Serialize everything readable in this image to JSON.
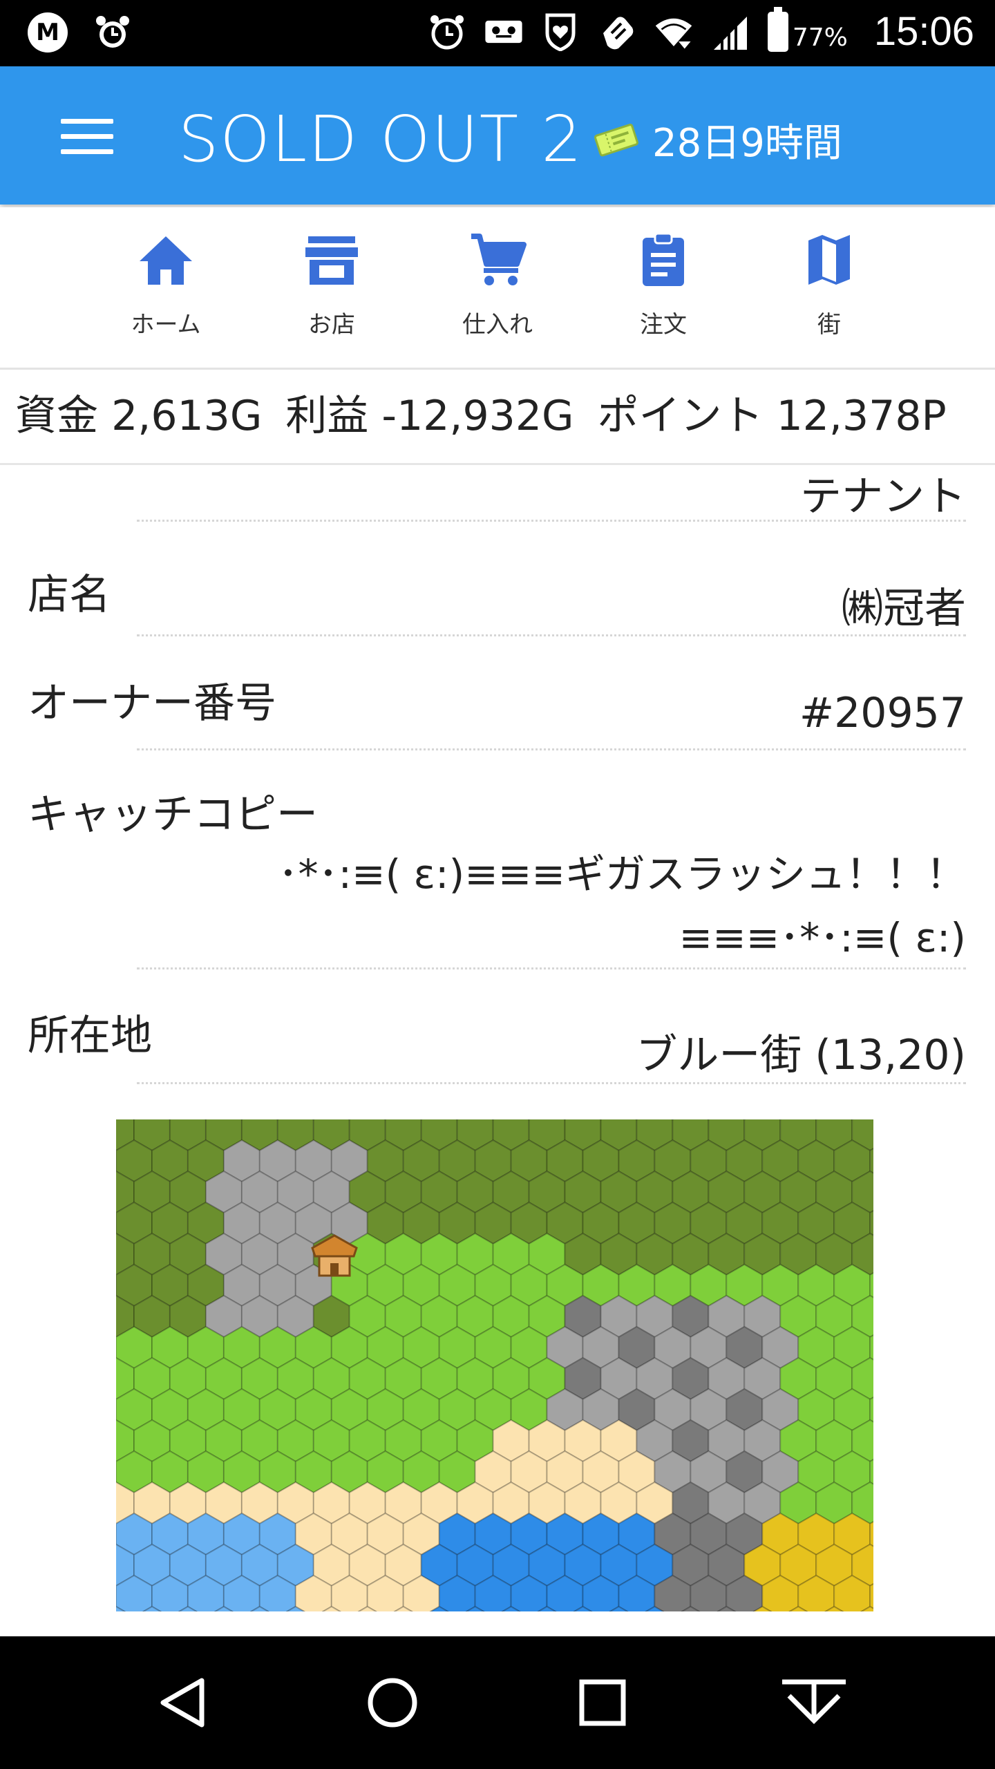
{
  "status_bar": {
    "left_icons": [
      "m-logo-icon",
      "alarm-icon"
    ],
    "right_icons": [
      "alarm-icon",
      "voicemail-icon",
      "heart-shield-icon",
      "hand-icon",
      "wifi-icon",
      "signal-icon",
      "battery-icon"
    ],
    "battery_percent": "77%",
    "time": "15:06",
    "m_logo_text": "M"
  },
  "app_bar": {
    "title": "SOLD OUT 2",
    "time_remaining": "28日9時間",
    "menu_icon": "hamburger-icon",
    "ticket_icon": "ticket-icon"
  },
  "nav": {
    "items": [
      {
        "label": "ホーム",
        "icon": "home-icon"
      },
      {
        "label": "お店",
        "icon": "store-icon"
      },
      {
        "label": "仕入れ",
        "icon": "cart-icon"
      },
      {
        "label": "注文",
        "icon": "clipboard-icon"
      },
      {
        "label": "街",
        "icon": "map-icon"
      }
    ],
    "accent": "#3a6fd8"
  },
  "stats": {
    "funds": "資金 2,613G",
    "profit": "利益 -12,932G",
    "points": "ポイント 12,378P"
  },
  "details": {
    "tenant_value": "テナント",
    "shop_name_label": "店名",
    "shop_name_value": "㈱冠者",
    "owner_label": "オーナー番号",
    "owner_value": "#20957",
    "catchcopy_label": "キャッチコピー",
    "catchcopy_line1": "･*･:≡( ε:)≡≡≡ギガスラッシュ！！！",
    "catchcopy_line2": "≡≡≡･*･:≡( ε:)",
    "location_label": "所在地",
    "location_value": "ブルー街 (13,20)"
  },
  "colors": {
    "app_bar": "#2f96ec",
    "forest": "#6b8f2e",
    "grass": "#7fcf3a",
    "rock": "#a3a3a3",
    "dark_rock": "#7a7a7a",
    "sand": "#fce3b0",
    "water": "#2e8ce8",
    "light_water": "#6ab2f2",
    "gold": "#e6c21e",
    "shop": "#d2852e"
  },
  "system_nav": [
    "back-icon",
    "home-circle-icon",
    "recents-icon",
    "download-icon"
  ]
}
